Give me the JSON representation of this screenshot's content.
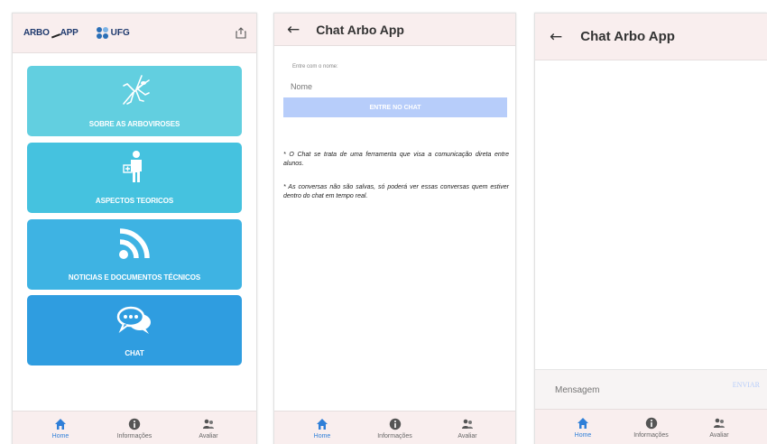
{
  "colors": {
    "appbar": "#f9eeee",
    "tile_1": "#62cfe0",
    "tile_2": "#45c2df",
    "tile_3": "#3eb3e3",
    "tile_4": "#2f9de0",
    "nav_active": "#2f7fd8",
    "enter_button": "#b7cdfa"
  },
  "home": {
    "logo_arbo": "ARBO",
    "logo_arbo_app": "APP",
    "logo_ufg": "UFG",
    "tiles": [
      {
        "label": "SOBRE AS ARBOVIROSES",
        "icon": "mosquito-icon"
      },
      {
        "label": "ASPECTOS TEORICOS",
        "icon": "doctor-icon"
      },
      {
        "label": "NOTICIAS E DOCUMENTOS TÉCNICOS",
        "icon": "rss-feed-icon"
      },
      {
        "label": "CHAT",
        "icon": "chat-bubbles-icon"
      }
    ]
  },
  "nav": {
    "home": "Home",
    "info": "Informações",
    "rate": "Avaliar"
  },
  "chat_entry": {
    "title": "Chat Arbo App",
    "field_label": "Entre com o nome:",
    "field_placeholder": "Nome",
    "enter_button": "ENTRE NO CHAT",
    "note_1": "* O Chat se trata de uma ferramenta que visa a comunicação direta entre alunos.",
    "note_2": "* As conversas não são salvas, só poderá ver essas conversas quem estiver dentro do chat em tempo real."
  },
  "chat_room": {
    "title": "Chat Arbo App",
    "message_placeholder": "Mensagem",
    "send_button": "ENVIAR"
  }
}
